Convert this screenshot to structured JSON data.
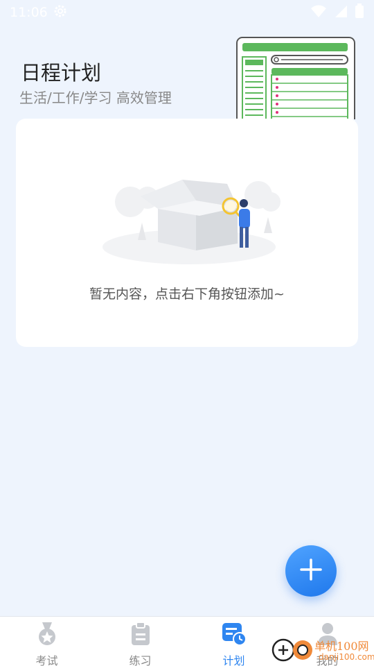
{
  "status_bar": {
    "time": "11:06"
  },
  "header": {
    "title": "日程计划",
    "subtitle": "生活/工作/学习 高效管理"
  },
  "empty_state": {
    "message": "暂无内容，点击右下角按钮添加~"
  },
  "fab": {
    "icon": "plus-icon"
  },
  "tabbar": {
    "tabs": [
      {
        "label": "考试",
        "icon": "medal-icon",
        "active": false
      },
      {
        "label": "练习",
        "icon": "clipboard-icon",
        "active": false
      },
      {
        "label": "计划",
        "icon": "schedule-icon",
        "active": true
      },
      {
        "label": "我的",
        "icon": "person-icon",
        "active": false
      }
    ]
  },
  "watermark": {
    "text": "单机100网",
    "sub": "danji100.com"
  },
  "colors": {
    "accent": "#2f86f0",
    "background": "#eef4fd",
    "green": "#5cb85c"
  }
}
